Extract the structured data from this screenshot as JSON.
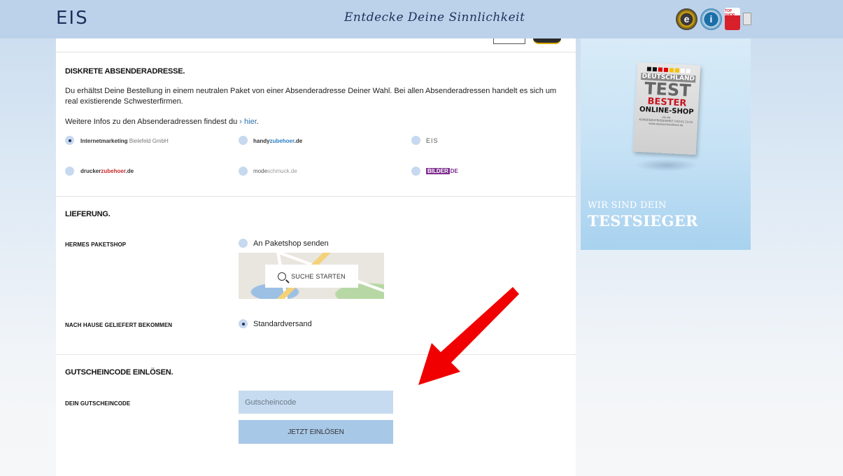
{
  "header": {
    "logo": "EIS",
    "tagline": "Entdecke Deine Sinnlichkeit",
    "seals": [
      "trusted-shops-seal",
      "ekomi-seal",
      "top-shop-seal",
      "mini-seal"
    ]
  },
  "sender": {
    "title": "DISKRETE ABSENDERADRESSE.",
    "description": "Du erhältst Deine Bestellung in einem neutralen Paket von einer Absenderadresse Deiner Wahl. Bei allen Absenderadressen handelt es sich um real existierende Schwesterfirmen.",
    "more_info_prefix": "Weitere Infos zu den Absenderadressen findest du ",
    "more_info_link": "hier",
    "more_info_suffix": ".",
    "options": [
      {
        "part1": "Internetmarketing",
        "part2": " Bielefeld GmbH",
        "checked": true
      },
      {
        "part1": "handy",
        "part2": "zubehoer",
        "part3": ".de",
        "checked": false
      },
      {
        "part1": "EIS",
        "checked": false
      },
      {
        "part1": "drucker",
        "part2": "zubehoer",
        "part3": ".de",
        "checked": false
      },
      {
        "part1": "mode",
        "part2": "schmuck.de",
        "checked": false
      },
      {
        "part1": "BILDER",
        "part2": "DE",
        "checked": false
      }
    ]
  },
  "delivery": {
    "title": "LIEFERUNG.",
    "hermes_label": "HERMES PAKETSHOP",
    "paketshop_option": "An Paketshop senden",
    "search_button": "SUCHE STARTEN",
    "home_label": "NACH HAUSE GELIEFERT BEKOMMEN",
    "standard_option": "Standardversand"
  },
  "coupon": {
    "title": "GUTSCHEINCODE EINLÖSEN.",
    "field_label": "DEIN GUTSCHEINCODE",
    "placeholder": "Gutscheincode",
    "button": "JETZT EINLÖSEN"
  },
  "ad": {
    "badge_top": "DEUTSCHLAND",
    "badge_test": "TEST",
    "badge_best": "BESTER",
    "badge_shop": "ONLINE-SHOP",
    "badge_site": "eis.de",
    "badge_sub": "KUNDENZUFRIEDENHEIT FOCUS 21/15",
    "badge_url": "www.deutschlandtest.de",
    "line1": "WIR SIND DEIN",
    "line2": "TESTSIEGER"
  },
  "colors": {
    "header_bg": "#bcd2ea",
    "accent_dark": "#1e2f5c",
    "input_bg": "#c6dbef",
    "button_bg": "#a8c8e8",
    "arrow": "#f00000"
  }
}
